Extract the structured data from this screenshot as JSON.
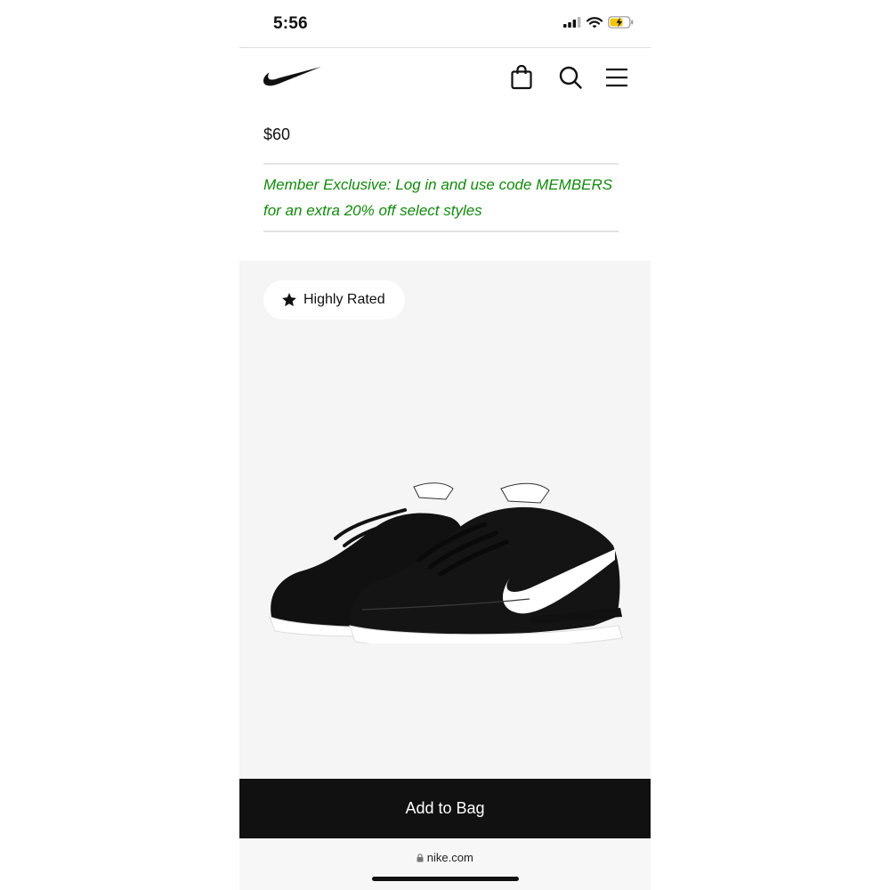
{
  "status_bar": {
    "time": "5:56"
  },
  "header": {
    "logo_icon": "nike-swoosh-icon",
    "bag_icon": "shopping-bag-icon",
    "search_icon": "search-icon",
    "menu_icon": "hamburger-menu-icon"
  },
  "product": {
    "price": "$60",
    "promo_line1": "Member Exclusive: Log in and use code MEMBERS",
    "promo_line2": "for an extra 20% off select styles",
    "badge_label": "Highly Rated",
    "badge_icon": "star-icon",
    "image": "black-white-sneakers"
  },
  "cta": {
    "label": "Add to Bag"
  },
  "browser": {
    "url": "nike.com",
    "lock_icon": "lock-icon"
  },
  "colors": {
    "promo_green": "#128a0c",
    "cta_black": "#111111",
    "image_bg": "#f5f5f5"
  }
}
